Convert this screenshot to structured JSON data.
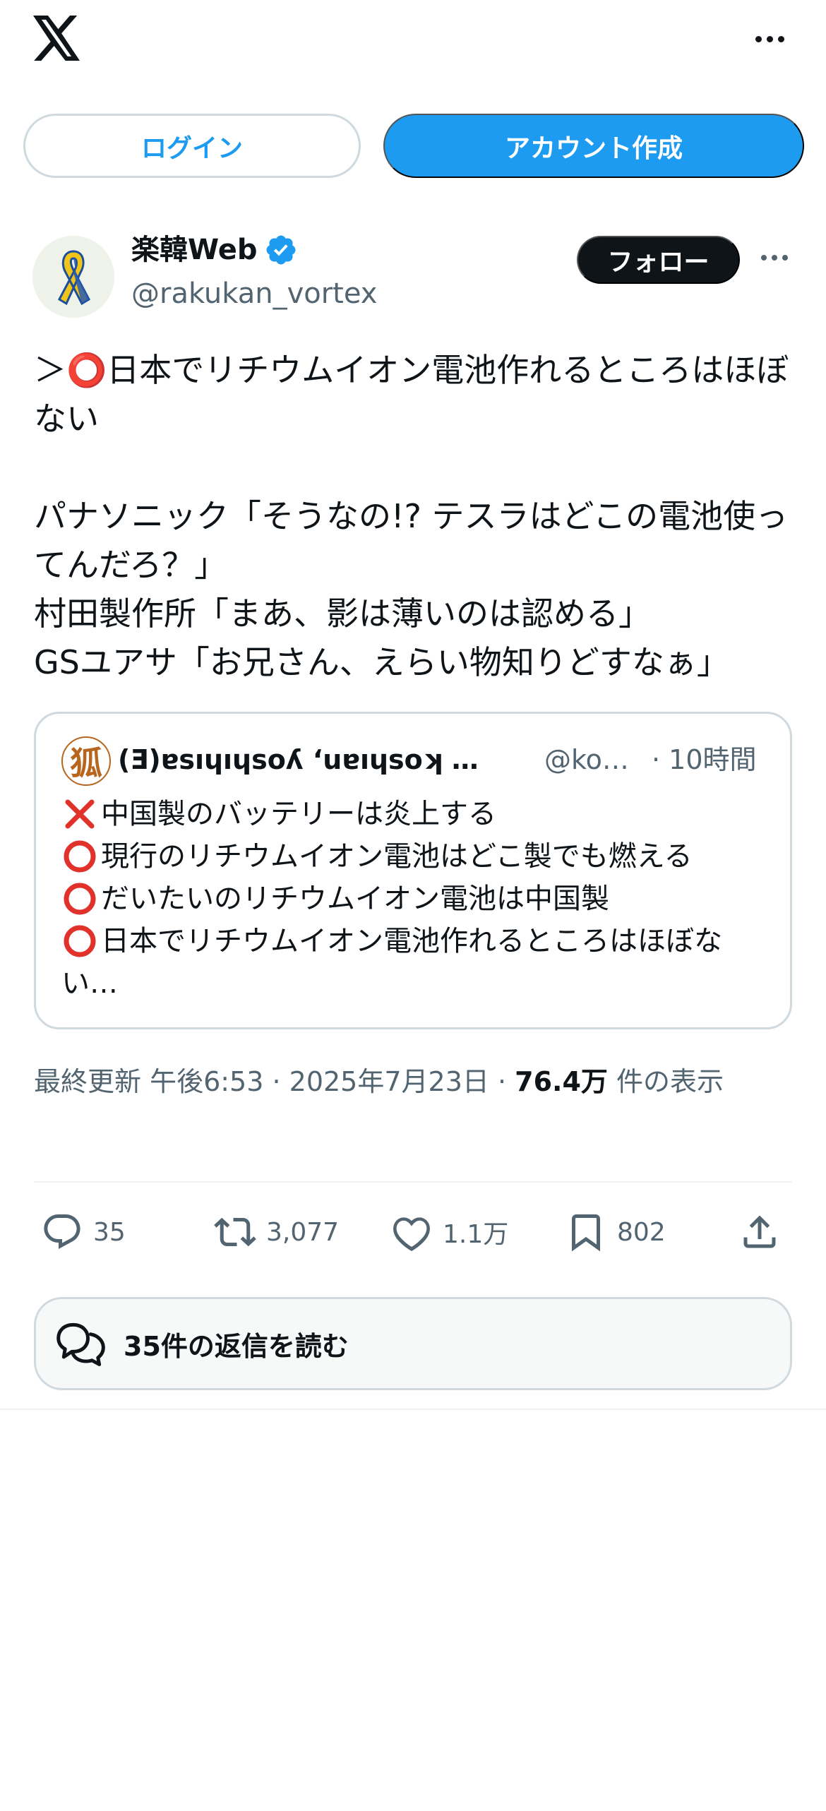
{
  "header": {
    "logo_icon": "x-logo-icon",
    "more_icon": "more-horizontal-icon"
  },
  "auth": {
    "login_label": "ログイン",
    "signup_label": "アカウント作成"
  },
  "post": {
    "author": {
      "display_name": "楽韓Web",
      "handle": "@rakukan_vortex",
      "verified": true,
      "avatar_icon": "ribbon-avatar"
    },
    "follow_label": "フォロー",
    "text": "＞⭕日本でリチウムイオン電池作れるところはほぼない\n\nパナソニック「そうなの!? テスラはどこの電池使ってんだろ？」\n村田製作所「まあ、影は薄いのは認める」\nGSユアサ「お兄さん、えらい物知りどすなぁ」",
    "quote": {
      "avatar_glyph": "狐",
      "display_name": "(Ǝ)ɐsıɥıɥsoʎ ‘uɐıɥsoʞ …",
      "handle": "@ko…",
      "time": "· 10時間",
      "lines": [
        {
          "mark": "cross",
          "text": "中国製のバッテリーは炎上する"
        },
        {
          "mark": "circle",
          "text": "現行のリチウムイオン電池はどこ製でも燃える"
        },
        {
          "mark": "circle",
          "text": "だいたいのリチウムイオン電池は中国製"
        },
        {
          "mark": "circle",
          "text": "日本でリチウムイオン電池作れるところはほぼな"
        }
      ],
      "continuation": "い…"
    },
    "meta": {
      "prefix": "最終更新 午後6:53 · 2025年7月23日 · ",
      "views": "76.4万",
      "views_suffix": " 件の表示"
    },
    "actions": {
      "replies": "35",
      "reposts": "3,077",
      "likes": "1.1万",
      "bookmarks": "802"
    },
    "read_replies_label": "35件の返信を読む"
  },
  "colors": {
    "accent": "#1d9bf0",
    "text": "#0f1419",
    "muted": "#536471",
    "border": "#cfd9de",
    "mark_red": "#e0312a"
  }
}
